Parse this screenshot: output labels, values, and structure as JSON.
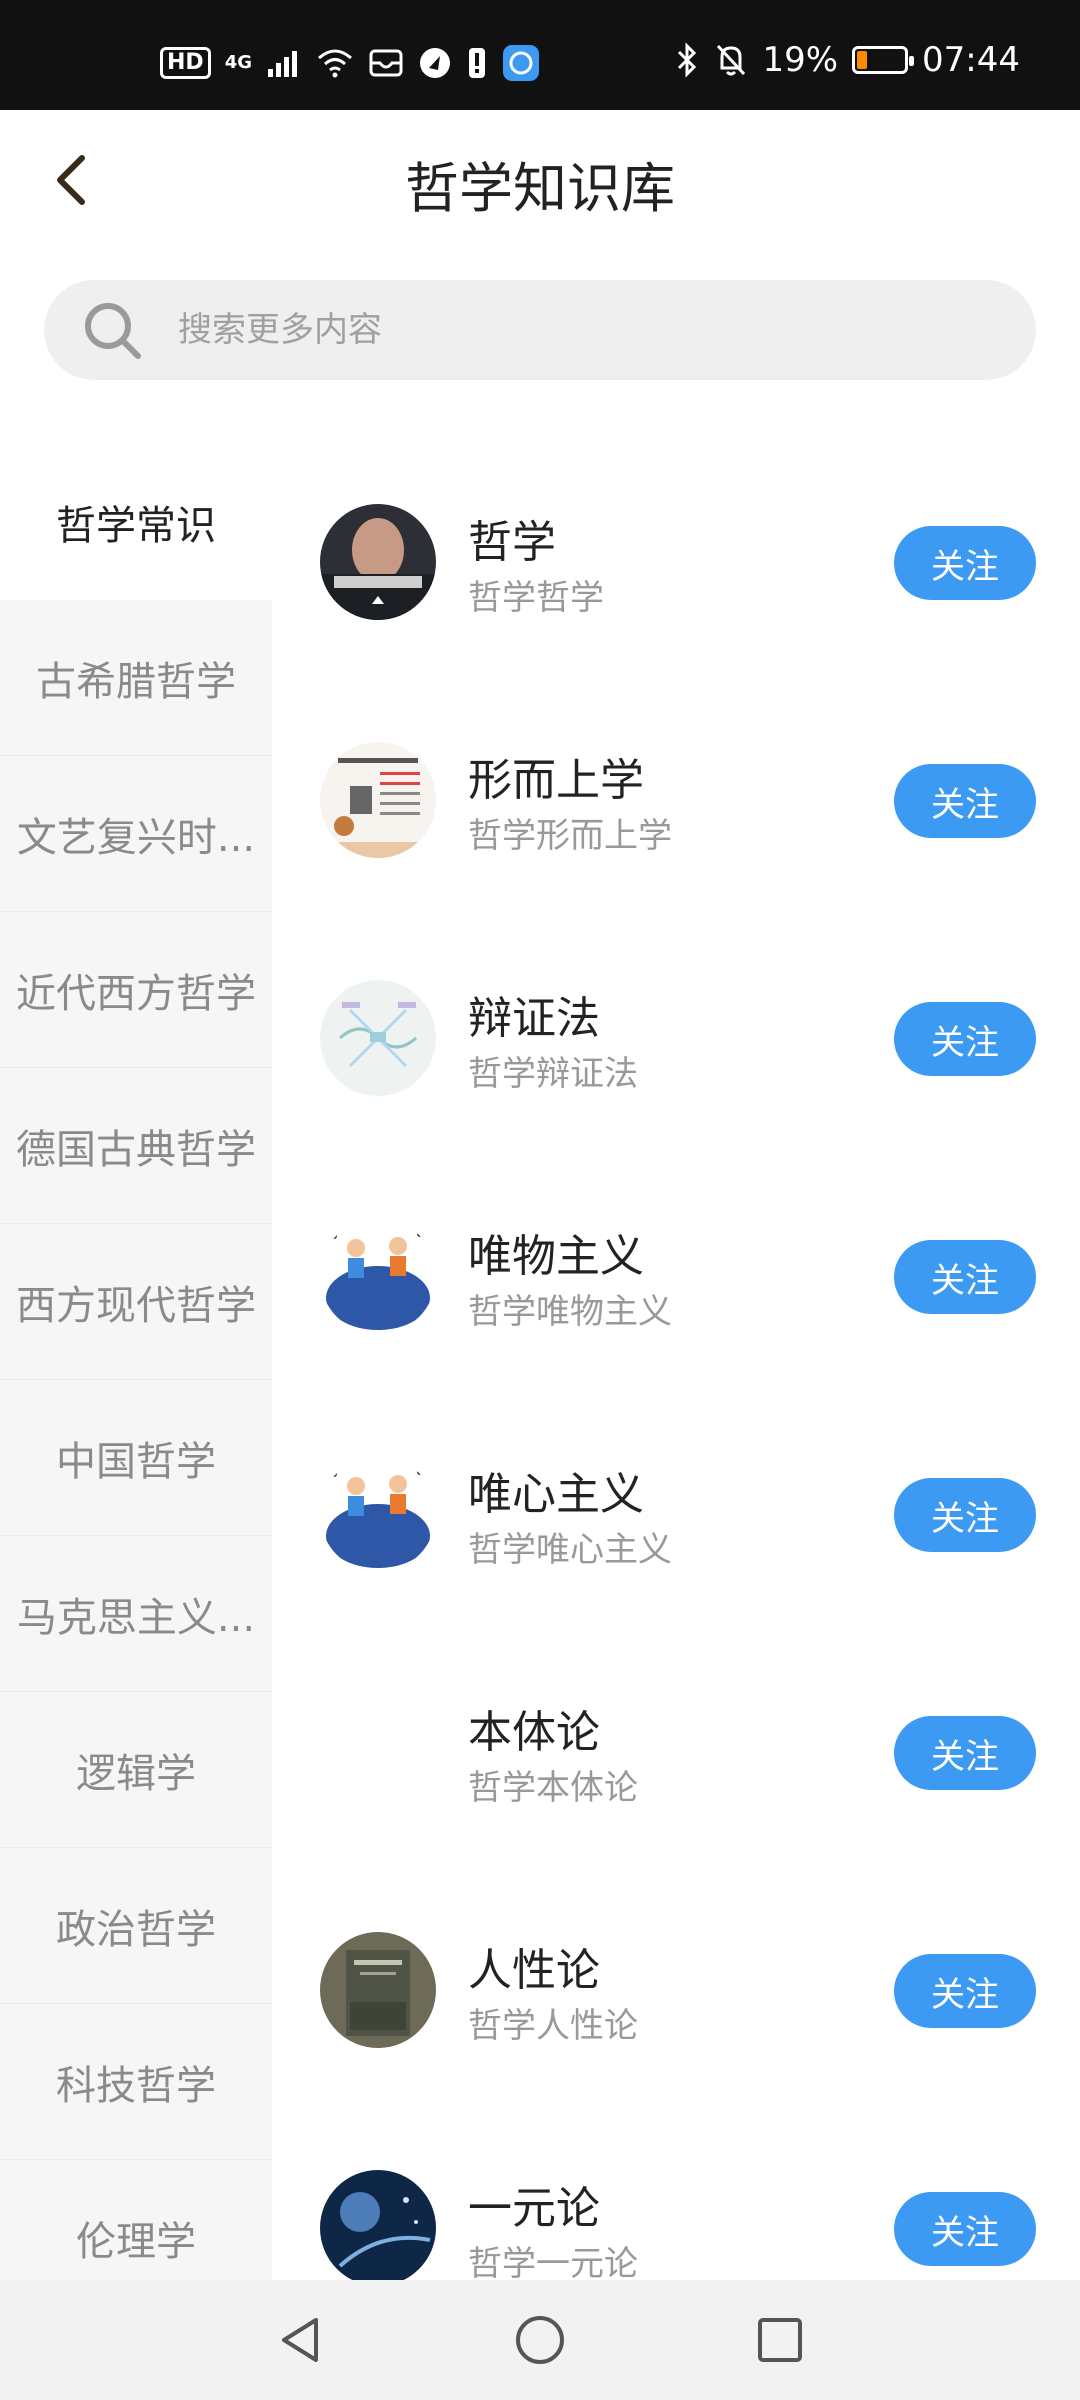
{
  "status_bar": {
    "hd": "HD",
    "network": "4G",
    "battery_percent": "19%",
    "battery_level": 0.19,
    "time": "07:44"
  },
  "header": {
    "title": "哲学知识库"
  },
  "search": {
    "placeholder": "搜索更多内容"
  },
  "sidebar": {
    "items": [
      {
        "label": "哲学常识",
        "active": true
      },
      {
        "label": "古希腊哲学"
      },
      {
        "label": "文艺复兴时..."
      },
      {
        "label": "近代西方哲学"
      },
      {
        "label": "德国古典哲学"
      },
      {
        "label": "西方现代哲学"
      },
      {
        "label": "中国哲学"
      },
      {
        "label": "马克思主义..."
      },
      {
        "label": "逻辑学"
      },
      {
        "label": "政治哲学"
      },
      {
        "label": "科技哲学"
      },
      {
        "label": "伦理学"
      }
    ]
  },
  "topics": [
    {
      "title": "哲学",
      "subtitle": "哲学哲学",
      "button": "关注",
      "avatar": "portrait-escape"
    },
    {
      "title": "形而上学",
      "subtitle": "哲学形而上学",
      "button": "关注",
      "avatar": "document-slide"
    },
    {
      "title": "辩证法",
      "subtitle": "哲学辩证法",
      "button": "关注",
      "avatar": "mindmap"
    },
    {
      "title": "唯物主义",
      "subtitle": "哲学唯物主义",
      "button": "关注",
      "avatar": "cartoon-globe"
    },
    {
      "title": "唯心主义",
      "subtitle": "哲学唯心主义",
      "button": "关注",
      "avatar": "cartoon-globe"
    },
    {
      "title": "本体论",
      "subtitle": "哲学本体论",
      "button": "关注",
      "avatar": "none"
    },
    {
      "title": "人性论",
      "subtitle": "哲学人性论",
      "button": "关注",
      "avatar": "book-cover"
    },
    {
      "title": "一元论",
      "subtitle": "哲学一元论",
      "button": "关注",
      "avatar": "space"
    }
  ],
  "colors": {
    "accent": "#3d9af2",
    "statusbar": "#111111",
    "sidebar_bg": "#f6f6f6"
  }
}
